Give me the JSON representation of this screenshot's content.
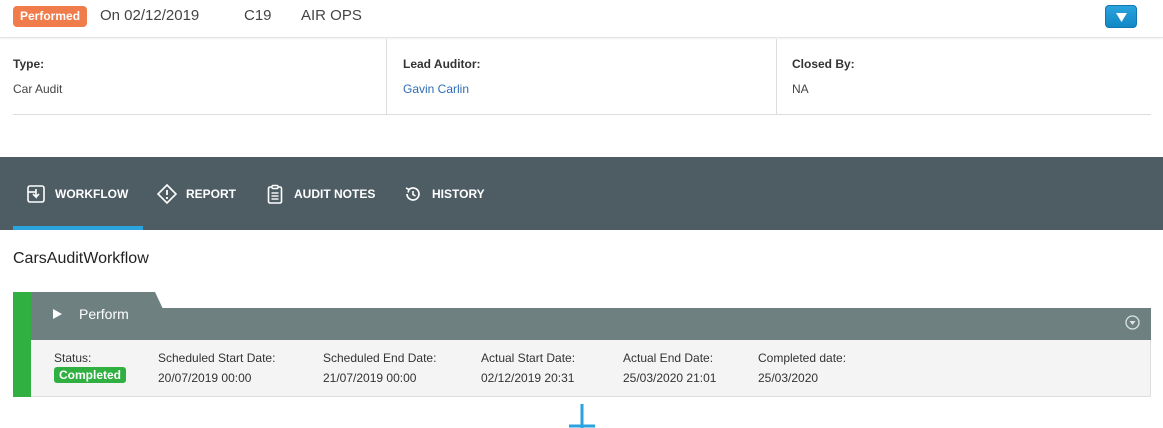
{
  "header": {
    "status_badge": "Performed",
    "date": "On 02/12/2019",
    "code": "C19",
    "department": "AIR OPS"
  },
  "info": {
    "type_label": "Type:",
    "type_value": "Car Audit",
    "lead_label": "Lead Auditor:",
    "lead_value": "Gavin Carlin",
    "closed_label": "Closed By:",
    "closed_value": "NA"
  },
  "tabs": [
    {
      "label": "WORKFLOW",
      "icon": "workflow-icon",
      "active": true
    },
    {
      "label": "REPORT",
      "icon": "diamond-icon",
      "active": false
    },
    {
      "label": "AUDIT NOTES",
      "icon": "clipboard-icon",
      "active": false
    },
    {
      "label": "HISTORY",
      "icon": "history-icon",
      "active": false
    }
  ],
  "workflow": {
    "title": "CarsAuditWorkflow",
    "stage": {
      "name": "Perform",
      "status_label": "Status:",
      "status_value": "Completed",
      "sched_start_label": "Scheduled Start Date:",
      "sched_start_value": "20/07/2019 00:00",
      "sched_end_label": "Scheduled End Date:",
      "sched_end_value": "21/07/2019 00:00",
      "actual_start_label": "Actual Start Date:",
      "actual_start_value": "02/12/2019 20:31",
      "actual_end_label": "Actual End Date:",
      "actual_end_value": "25/03/2020 21:01",
      "completed_label": "Completed date:",
      "completed_value": "25/03/2020"
    }
  },
  "colors": {
    "badge": "#f07c4b",
    "tab_bar": "#4e5d64",
    "active_underline": "#2aa3de",
    "stage_green": "#2fb040",
    "stage_header": "#6e8080",
    "link": "#2e6db4"
  }
}
